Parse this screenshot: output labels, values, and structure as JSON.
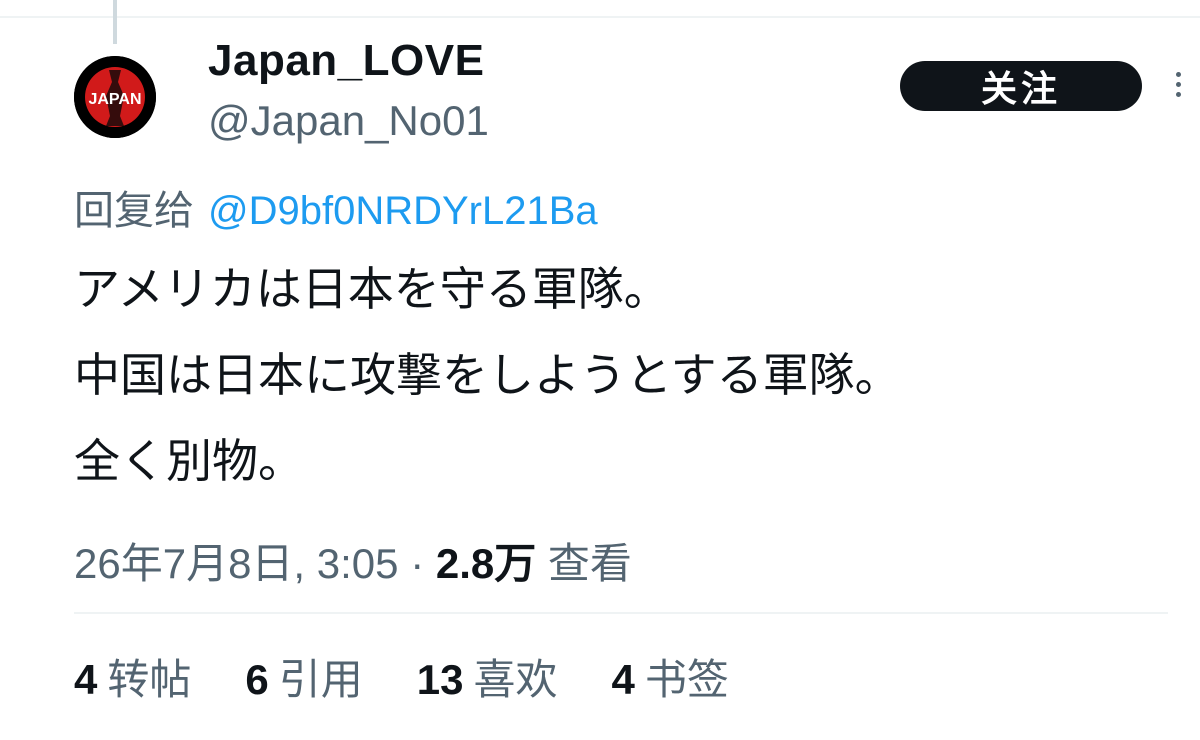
{
  "author": {
    "display_name": "Japan_LOVE",
    "handle": "@Japan_No01",
    "avatar_text": "JAPAN"
  },
  "follow_label": "关注",
  "reply_to": {
    "prefix": "回复给",
    "mention": "@D9bf0NRDYrL21Ba"
  },
  "tweet_lines": [
    "アメリカは日本を守る軍隊。",
    "中国は日本に攻撃をしようとする軍隊。",
    "全く別物。"
  ],
  "meta": {
    "timestamp": "26年7月8日, 3:05",
    "separator": " · ",
    "views": "2.8万",
    "views_label": "查看"
  },
  "stats": [
    {
      "count": "4",
      "label": "转帖"
    },
    {
      "count": "6",
      "label": "引用"
    },
    {
      "count": "13",
      "label": "喜欢"
    },
    {
      "count": "4",
      "label": "书签"
    }
  ],
  "colors": {
    "text": "#0f1419",
    "secondary": "#536471",
    "link": "#1d9bf0",
    "button": "#0f1419",
    "avatar_red": "#d11a1a"
  },
  "icons": {
    "more": "more-vertical-icon"
  }
}
